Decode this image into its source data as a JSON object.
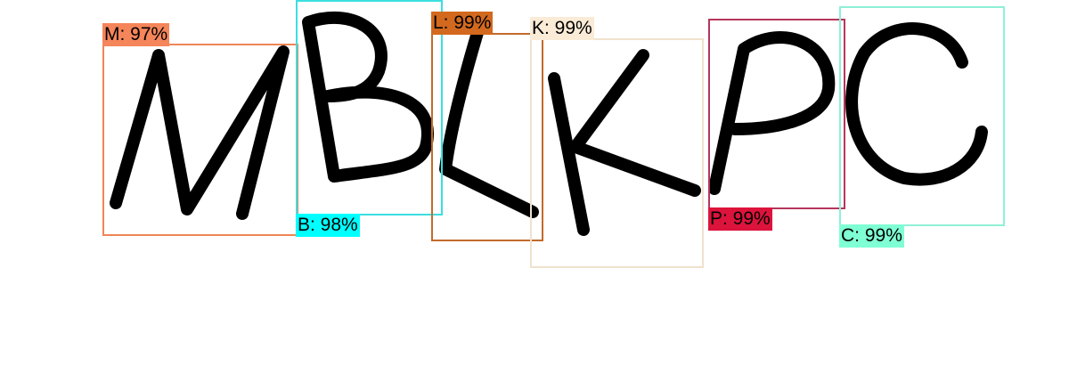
{
  "detections": [
    {
      "label": "M: 97%",
      "char": "M",
      "color": "#ee8557",
      "tag_color": "#f5855a"
    },
    {
      "label": "B: 98%",
      "char": "B",
      "color": "#3bdfe0",
      "tag_color": "#00ffff"
    },
    {
      "label": "L: 99%",
      "char": "L",
      "color": "#c26a2b",
      "tag_color": "#d2691e"
    },
    {
      "label": "K: 99%",
      "char": "K",
      "color": "#f0e2cd",
      "tag_color": "#faebd7"
    },
    {
      "label": "P: 99%",
      "char": "P",
      "color": "#b5365c",
      "tag_color": "#dc143c"
    },
    {
      "label": "C: 99%",
      "char": "C",
      "color": "#8ff0d6",
      "tag_color": "#7fffd4"
    }
  ]
}
